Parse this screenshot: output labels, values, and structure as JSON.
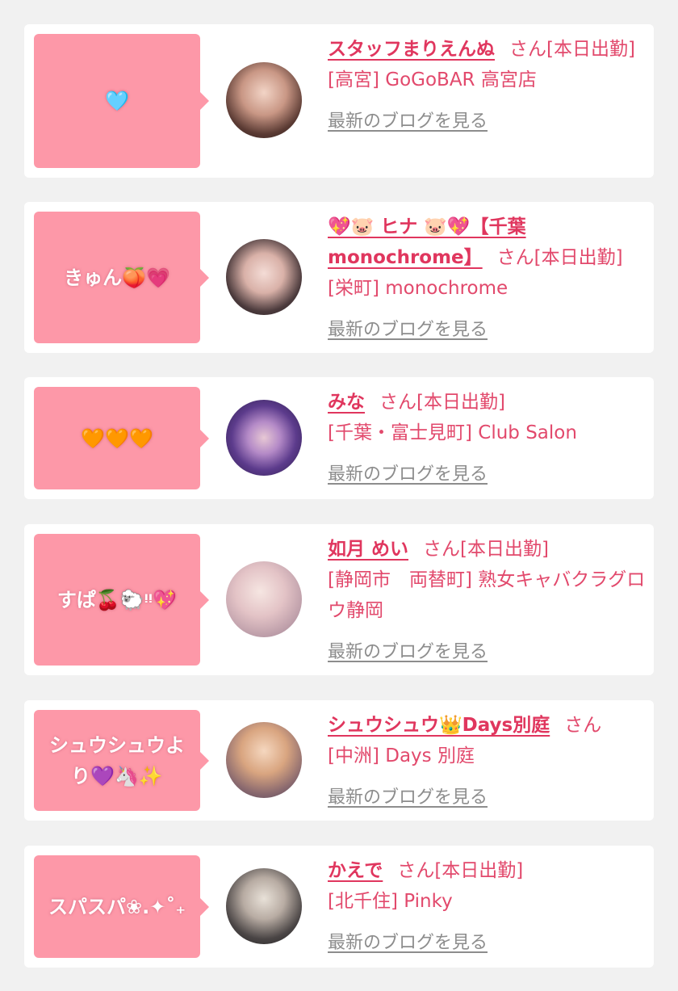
{
  "accent": "#e0365e",
  "bubble_color": "#fd98a8",
  "blog_link_label": "最新のブログを見る",
  "san_label": "さん",
  "entries": [
    {
      "message": "🩵",
      "name": "スタッフまりえんぬ",
      "suffix": "[本日出勤]",
      "shop": "[高宮] GoGoBAR 高宮店",
      "blog": "最新のブログを見る",
      "avatar_icon": "portrait-photo"
    },
    {
      "message": "きゅん🍑💗",
      "name": "💖🐷 ヒナ 🐷💖【千葉monochrome】",
      "suffix": "[本日出勤]",
      "shop": "[栄町] monochrome",
      "blog": "最新のブログを見る",
      "avatar_icon": "portrait-photo"
    },
    {
      "message": "🧡🧡🧡",
      "name": "みな",
      "suffix": "[本日出勤]",
      "shop": "[千葉・富士見町] Club Salon",
      "blog": "最新のブログを見る",
      "avatar_icon": "portrait-photo"
    },
    {
      "message": "すぱ🍒🐑ᵎᵎ💖",
      "name": "如月 めい",
      "suffix": "[本日出勤]",
      "shop": "[静岡市　両替町] 熟女キャバクラグロウ静岡",
      "blog": "最新のブログを見る",
      "avatar_icon": "portrait-photo"
    },
    {
      "message": "シュウシュウより💜🦄✨",
      "name": "シュウシュウ👑Days別庭",
      "suffix": "",
      "shop": "[中洲] Days 別庭",
      "blog": "最新のブログを見る",
      "avatar_icon": "portrait-photo"
    },
    {
      "message": "スパスパ❀.✦˚₊",
      "name": "かえで",
      "suffix": "[本日出勤]",
      "shop": "[北千住] Pinky",
      "blog": "最新のブログを見る",
      "avatar_icon": "portrait-photo"
    }
  ]
}
